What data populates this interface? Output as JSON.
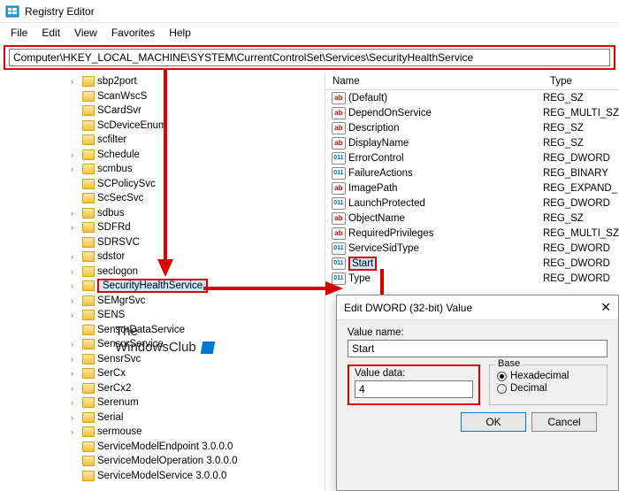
{
  "app": {
    "title": "Registry Editor"
  },
  "menu": {
    "file": "File",
    "edit": "Edit",
    "view": "View",
    "favorites": "Favorites",
    "help": "Help"
  },
  "address": {
    "path": "Computer\\HKEY_LOCAL_MACHINE\\SYSTEM\\CurrentControlSet\\Services\\SecurityHealthService"
  },
  "columns": {
    "name": "Name",
    "type": "Type"
  },
  "tree": [
    {
      "label": "sbp2port",
      "exp": true
    },
    {
      "label": "ScanWscS",
      "exp": false
    },
    {
      "label": "SCardSvr",
      "exp": false
    },
    {
      "label": "ScDeviceEnum",
      "exp": false
    },
    {
      "label": "scfilter",
      "exp": false
    },
    {
      "label": "Schedule",
      "exp": true
    },
    {
      "label": "scmbus",
      "exp": true
    },
    {
      "label": "SCPolicySvc",
      "exp": false
    },
    {
      "label": "ScSecSvc",
      "exp": false
    },
    {
      "label": "sdbus",
      "exp": true
    },
    {
      "label": "SDFRd",
      "exp": true
    },
    {
      "label": "SDRSVC",
      "exp": false
    },
    {
      "label": "sdstor",
      "exp": true
    },
    {
      "label": "seclogon",
      "exp": true
    },
    {
      "label": "SecurityHealthService",
      "exp": true,
      "selected": true
    },
    {
      "label": "SEMgrSvc",
      "exp": true
    },
    {
      "label": "SENS",
      "exp": true
    },
    {
      "label": "SensorDataService",
      "exp": false
    },
    {
      "label": "SensorService",
      "exp": true
    },
    {
      "label": "SensrSvc",
      "exp": true
    },
    {
      "label": "SerCx",
      "exp": true
    },
    {
      "label": "SerCx2",
      "exp": true
    },
    {
      "label": "Serenum",
      "exp": true
    },
    {
      "label": "Serial",
      "exp": true
    },
    {
      "label": "sermouse",
      "exp": true
    },
    {
      "label": "ServiceModelEndpoint 3.0.0.0",
      "exp": false
    },
    {
      "label": "ServiceModelOperation 3.0.0.0",
      "exp": false
    },
    {
      "label": "ServiceModelService 3.0.0.0",
      "exp": false
    }
  ],
  "values": [
    {
      "name": "(Default)",
      "type": "REG_SZ",
      "kind": "ab"
    },
    {
      "name": "DependOnService",
      "type": "REG_MULTI_SZ",
      "kind": "ab"
    },
    {
      "name": "Description",
      "type": "REG_SZ",
      "kind": "ab"
    },
    {
      "name": "DisplayName",
      "type": "REG_SZ",
      "kind": "ab"
    },
    {
      "name": "ErrorControl",
      "type": "REG_DWORD",
      "kind": "011"
    },
    {
      "name": "FailureActions",
      "type": "REG_BINARY",
      "kind": "011"
    },
    {
      "name": "ImagePath",
      "type": "REG_EXPAND_",
      "kind": "ab"
    },
    {
      "name": "LaunchProtected",
      "type": "REG_DWORD",
      "kind": "011"
    },
    {
      "name": "ObjectName",
      "type": "REG_SZ",
      "kind": "ab"
    },
    {
      "name": "RequiredPrivileges",
      "type": "REG_MULTI_SZ",
      "kind": "ab"
    },
    {
      "name": "ServiceSidType",
      "type": "REG_DWORD",
      "kind": "011"
    },
    {
      "name": "Start",
      "type": "REG_DWORD",
      "kind": "011",
      "highlight": true
    },
    {
      "name": "Type",
      "type": "REG_DWORD",
      "kind": "011"
    }
  ],
  "dialog": {
    "title": "Edit DWORD (32-bit) Value",
    "valueNameLabel": "Value name:",
    "valueName": "Start",
    "valueDataLabel": "Value data:",
    "valueData": "4",
    "baseLabel": "Base",
    "hex": "Hexadecimal",
    "dec": "Decimal",
    "ok": "OK",
    "cancel": "Cancel"
  },
  "watermark": {
    "line1": "The",
    "line2": "WindowsClub"
  }
}
